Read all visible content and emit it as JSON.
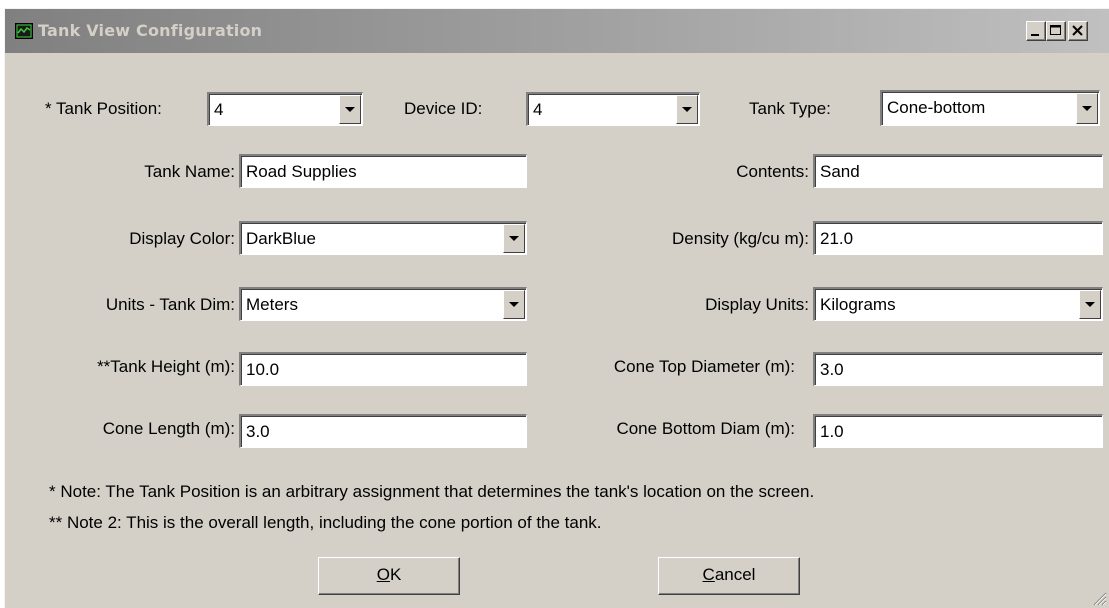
{
  "window": {
    "title": "Tank View Configuration"
  },
  "form": {
    "tank_position": {
      "label": "* Tank Position:",
      "value": "4"
    },
    "device_id": {
      "label": "Device ID:",
      "value": "4"
    },
    "tank_type": {
      "label": "Tank Type:",
      "value": "Cone-bottom"
    },
    "tank_name": {
      "label": "Tank Name:",
      "value": "Road Supplies"
    },
    "contents": {
      "label": "Contents:",
      "value": "Sand"
    },
    "display_color": {
      "label": "Display Color:",
      "value": "DarkBlue"
    },
    "density": {
      "label": "Density (kg/cu m):",
      "value": "21.0"
    },
    "units_tank_dim": {
      "label": "Units - Tank Dim:",
      "value": "Meters"
    },
    "display_units": {
      "label": "Display Units:",
      "value": "Kilograms"
    },
    "tank_height": {
      "label": "**Tank Height (m):",
      "value": "10.0"
    },
    "cone_top_diameter": {
      "label": "Cone Top Diameter (m):",
      "value": "3.0"
    },
    "cone_length": {
      "label": "Cone Length (m):",
      "value": "3.0"
    },
    "cone_bottom_diam": {
      "label": "Cone Bottom Diam (m):",
      "value": "1.0"
    }
  },
  "notes": {
    "note1": "* Note:  The Tank Position is an arbitrary assignment that determines the tank's location on the screen.",
    "note2": "** Note 2:  This is the overall length, including the cone portion of the tank."
  },
  "buttons": {
    "ok": {
      "mnemonic": "O",
      "rest": "K"
    },
    "cancel": {
      "mnemonic": "C",
      "rest": "ancel"
    }
  },
  "icons": {
    "app": "tank-chart-icon",
    "minimize": "minimize-icon",
    "maximize": "maximize-icon",
    "close": "close-icon",
    "dropdown": "chevron-down-icon",
    "grip": "resize-grip-icon"
  },
  "colors": {
    "face": "#d4d0c8",
    "title_start": "#808080",
    "title_end": "#c0c0c0"
  }
}
